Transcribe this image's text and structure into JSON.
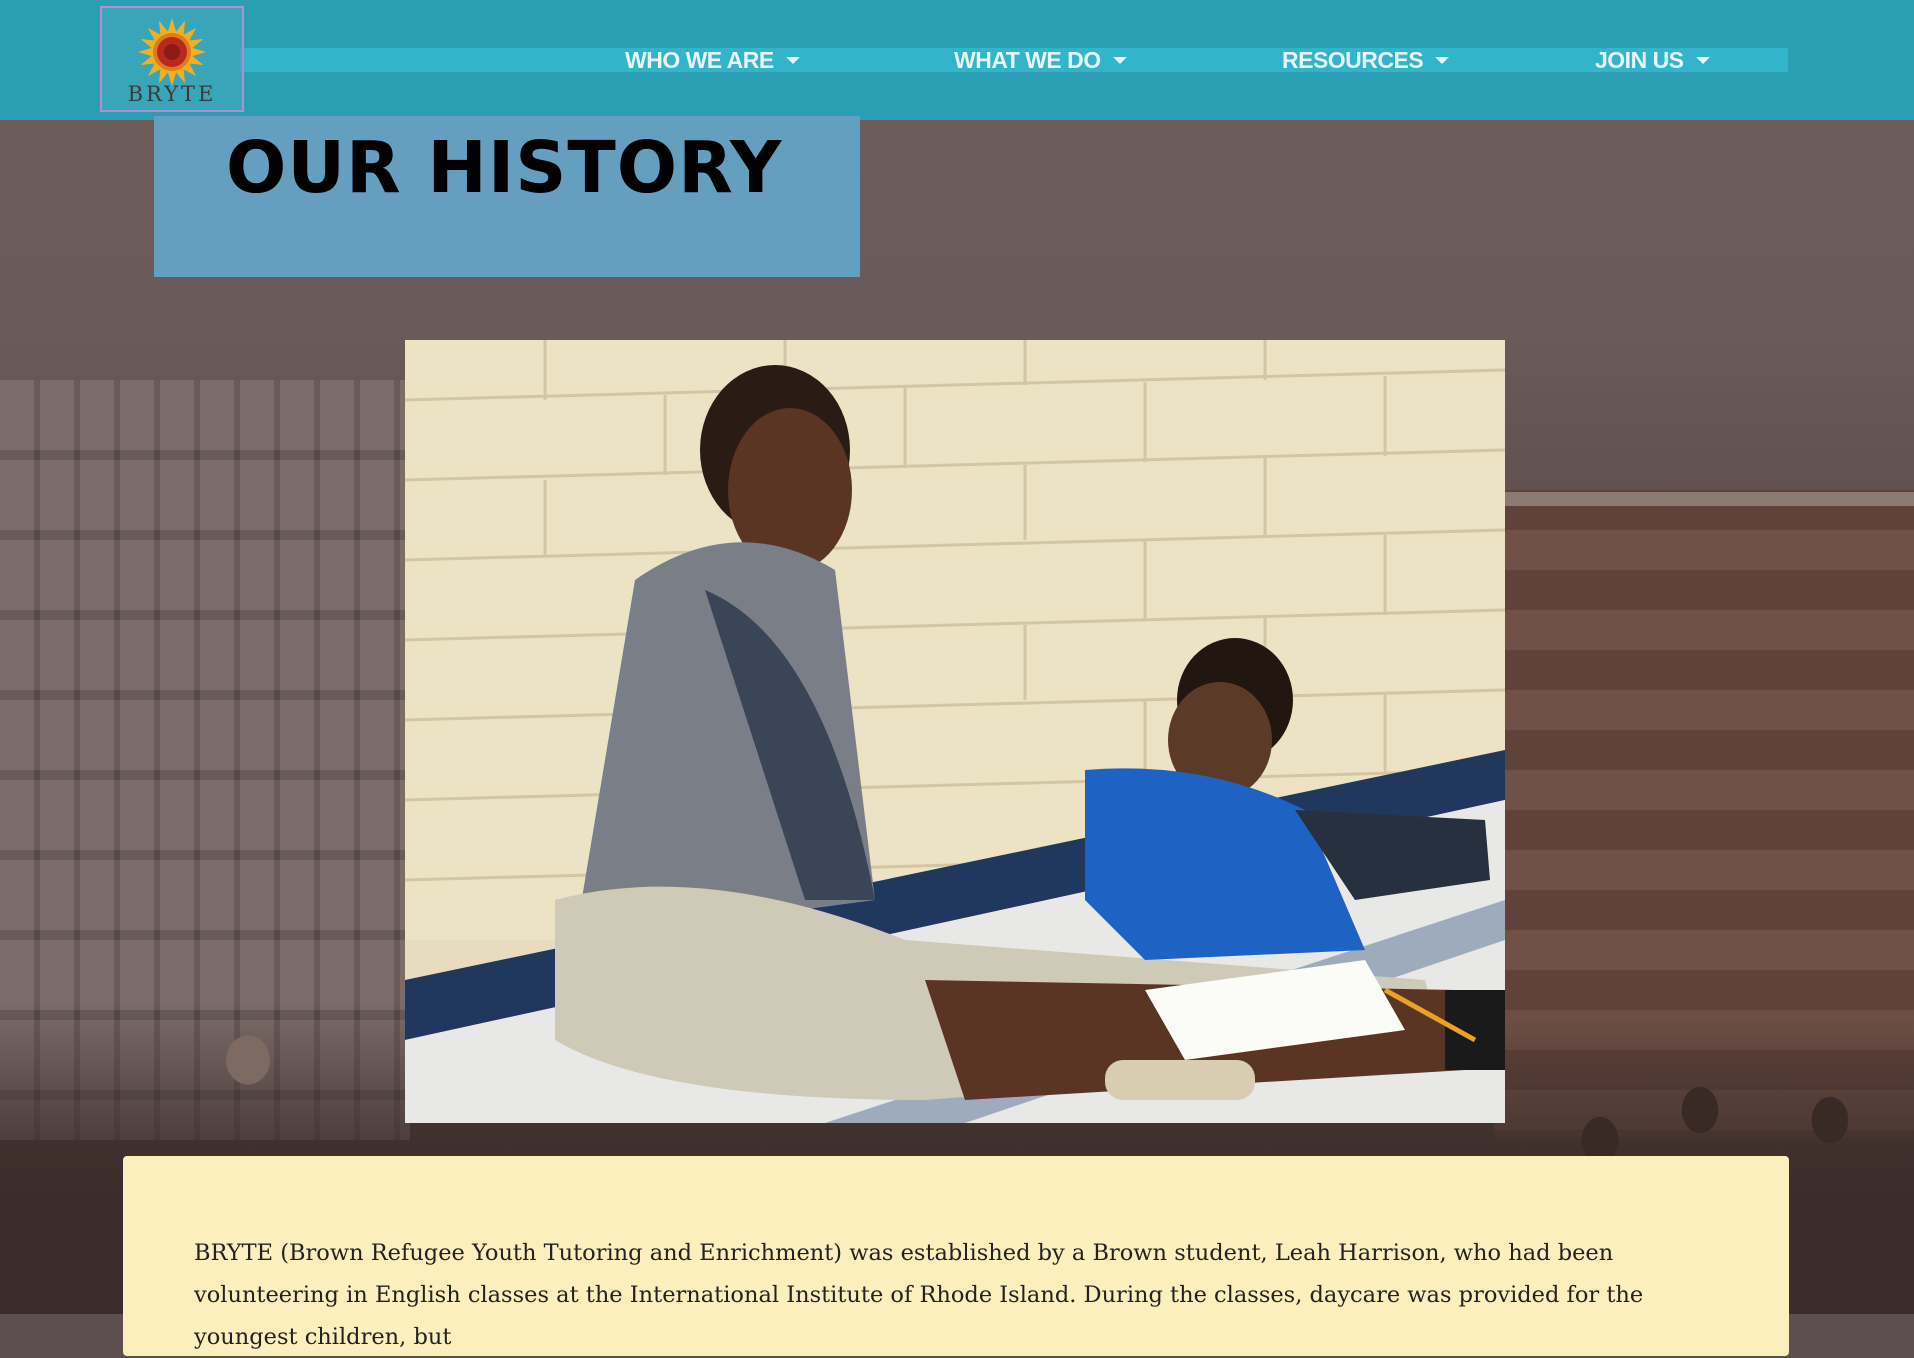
{
  "brand": {
    "name": "BRYTE",
    "logo_icon": "sunflower-icon"
  },
  "nav": {
    "items": [
      {
        "label": "WHO WE ARE"
      },
      {
        "label": "WHAT WE DO"
      },
      {
        "label": "RESOURCES"
      },
      {
        "label": "JOIN US"
      }
    ]
  },
  "page": {
    "title": "OUR HISTORY"
  },
  "hero": {
    "image": "tutor-and-child-photo"
  },
  "history": {
    "text": "BRYTE (Brown Refugee Youth Tutoring and Enrichment) was established by a Brown student, Leah Harrison, who had been volunteering in English classes at the International Institute of Rhode Island. During the classes, daycare was provided for the youngest children, but"
  },
  "colors": {
    "navbar": "#2a9fb3",
    "title_box": "#649fbf",
    "card": "#fcefbe"
  }
}
